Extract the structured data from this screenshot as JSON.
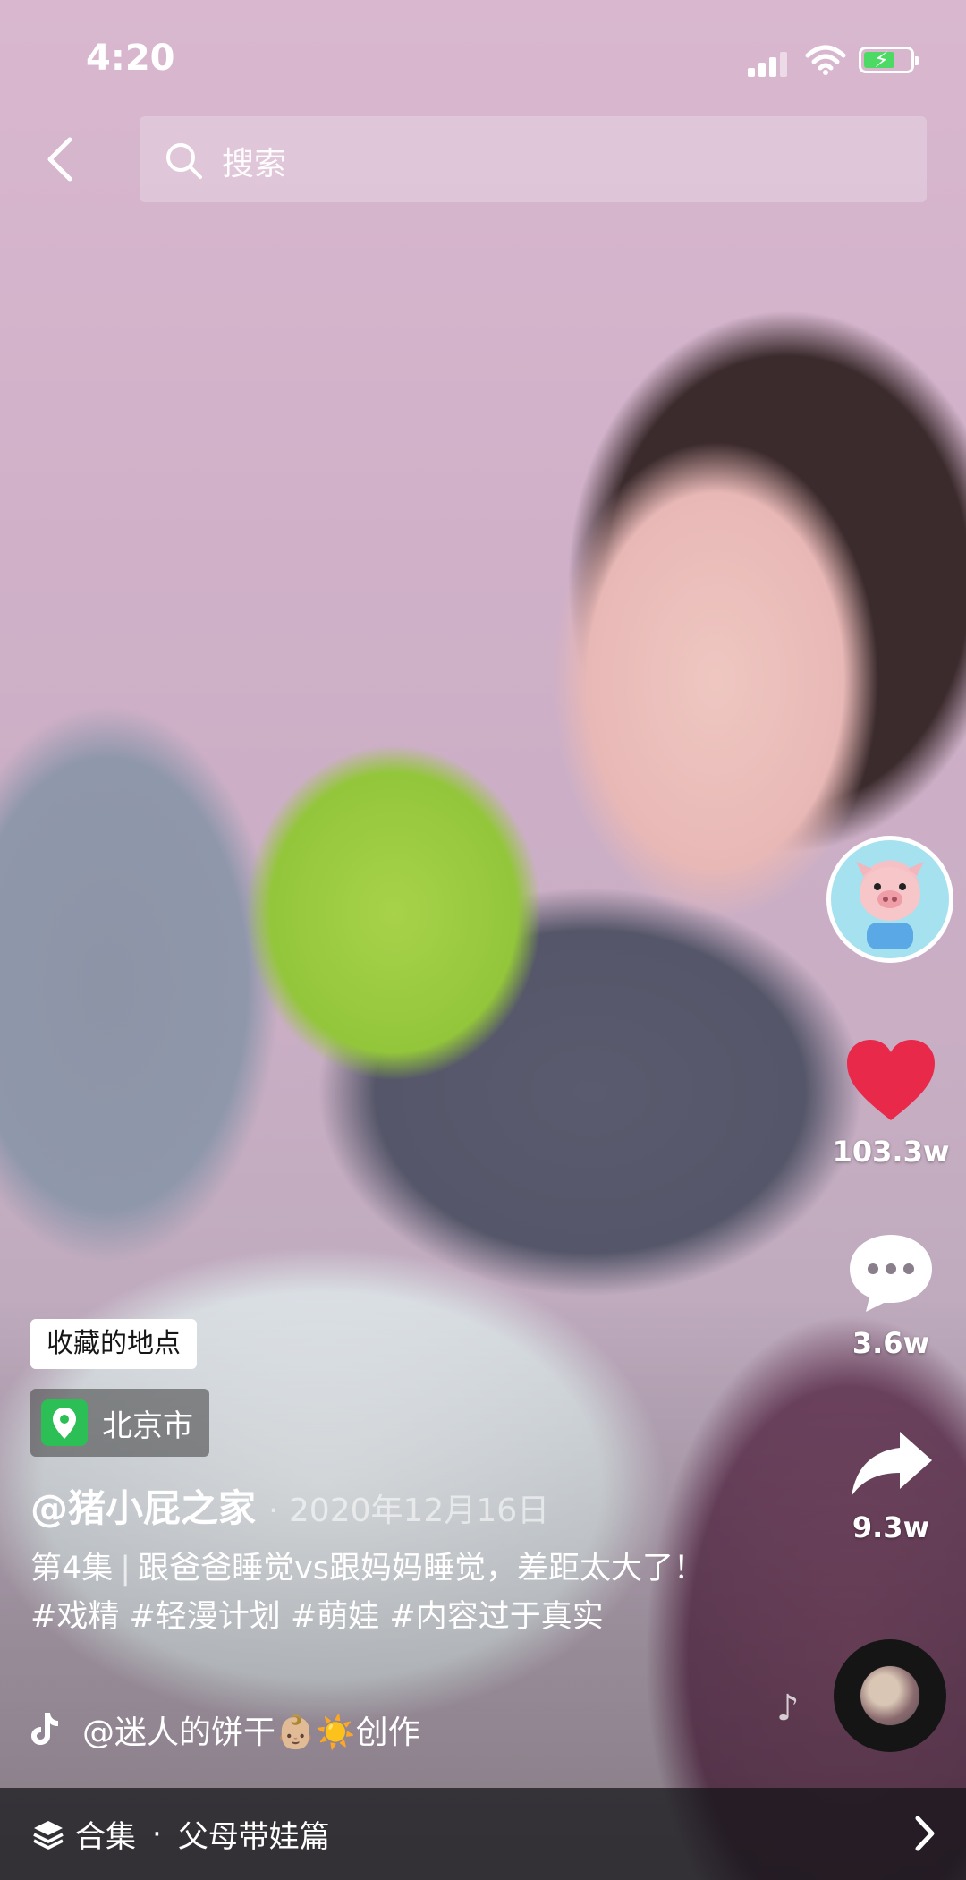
{
  "status_bar": {
    "time": "4:20"
  },
  "search": {
    "placeholder": "搜索"
  },
  "actions": {
    "likes": "103.3w",
    "comments": "3.6w",
    "shares": "9.3w"
  },
  "post": {
    "saved_places_tag": "收藏的地点",
    "location": "北京市",
    "author": "@猪小屁之家",
    "date": "· 2020年12月16日",
    "caption_part1": "第4集",
    "caption_sep": "|",
    "caption_part2": "跟爸爸睡觉vs跟妈妈睡觉，差距太大了！",
    "hashtags": [
      "#戏精",
      "#轻漫计划",
      "#萌娃",
      "#内容过于真实"
    ],
    "music_credit": "@迷人的饼干👶🏼☀️创作"
  },
  "collection": {
    "label": "合集",
    "dot": "·",
    "title": "父母带娃篇"
  },
  "colors": {
    "like_red": "#e8294a",
    "location_green": "#2cbf55"
  },
  "icons": [
    "back-icon",
    "search-icon",
    "heart-icon",
    "comment-icon",
    "share-icon",
    "music-note-icon",
    "tiktok-icon",
    "stack-icon",
    "chevron-right-icon",
    "location-pin-icon"
  ]
}
